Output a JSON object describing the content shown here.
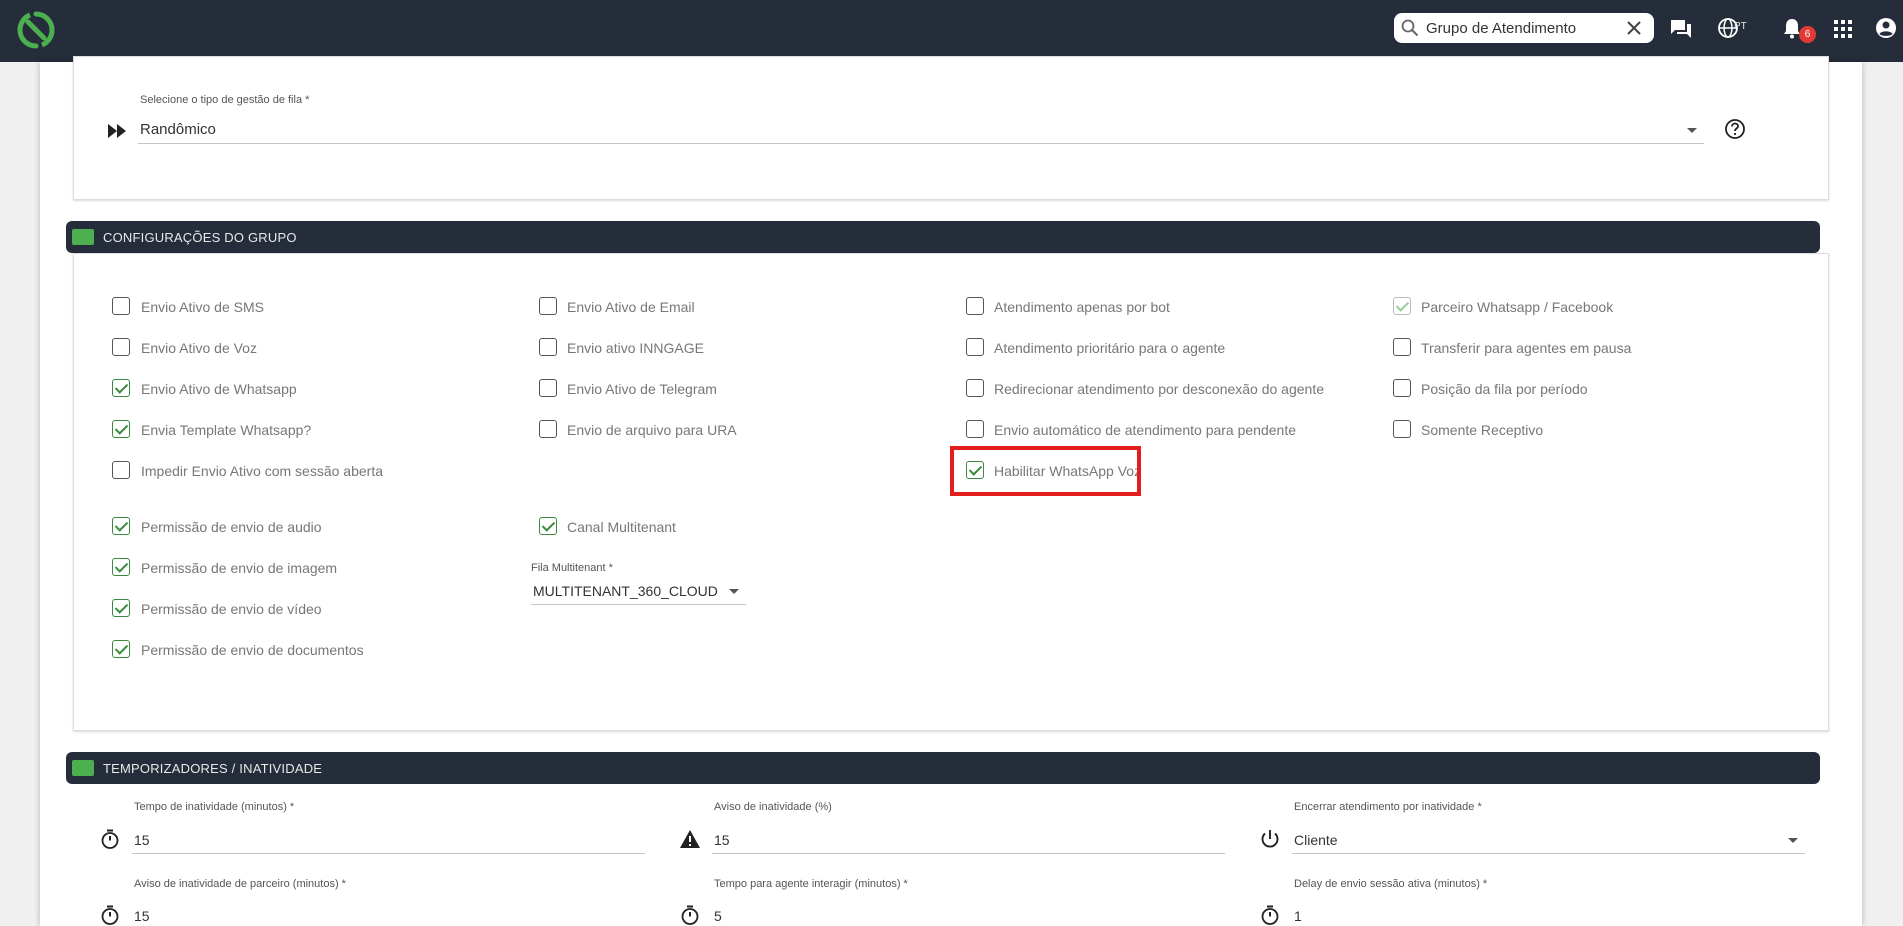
{
  "header": {
    "search": {
      "value": "Grupo de Atendimento"
    },
    "language": "PT",
    "notifications_count": "6"
  },
  "queue": {
    "label": "Selecione o tipo de gestão de fila *",
    "value": "Randômico"
  },
  "group_settings": {
    "title": "CONFIGURAÇÕES DO GRUPO",
    "checkboxes": [
      {
        "label": "Envio Ativo de SMS",
        "checked": false
      },
      {
        "label": "Envio Ativo de Email",
        "checked": false
      },
      {
        "label": "Atendimento apenas por bot",
        "checked": false
      },
      {
        "label": "Parceiro Whatsapp / Facebook",
        "checked": true,
        "disabled": true
      },
      {
        "label": "Envio Ativo de Voz",
        "checked": false
      },
      {
        "label": "Envio ativo INNGAGE",
        "checked": false
      },
      {
        "label": "Atendimento prioritário para o agente",
        "checked": false
      },
      {
        "label": "Transferir para agentes em pausa",
        "checked": false
      },
      {
        "label": "Envio Ativo de Whatsapp",
        "checked": true
      },
      {
        "label": "Envio Ativo de Telegram",
        "checked": false
      },
      {
        "label": "Redirecionar atendimento por desconexão do agente",
        "checked": false
      },
      {
        "label": "Posição da fila por período",
        "checked": false
      },
      {
        "label": "Envia Template Whatsapp?",
        "checked": true
      },
      {
        "label": "Envio de arquivo para URA",
        "checked": false
      },
      {
        "label": "Envio automático de atendimento para pendente",
        "checked": false
      },
      {
        "label": "Somente Receptivo",
        "checked": false
      },
      {
        "label": "Impedir Envio Ativo com sessão aberta",
        "checked": false
      },
      {
        "label": "Habilitar WhatsApp Voz",
        "checked": true
      },
      {
        "label": "Permissão de envio de audio",
        "checked": true
      },
      {
        "label": "Canal Multitenant",
        "checked": true
      },
      {
        "label": "Permissão de envio de imagem",
        "checked": true
      },
      {
        "label": "Permissão de envio de vídeo",
        "checked": true
      },
      {
        "label": "Permissão de envio de documentos",
        "checked": true
      }
    ],
    "multitenant_queue": {
      "label": "Fila Multitenant *",
      "value": "MULTITENANT_360_CLOUD"
    }
  },
  "timers": {
    "title": "TEMPORIZADORES / INATIVIDADE",
    "fields": [
      {
        "label": "Tempo de inatividade (minutos) *",
        "value": "15"
      },
      {
        "label": "Aviso de inatividade (%)",
        "value": "15"
      },
      {
        "label": "Encerrar atendimento por inatividade *",
        "value": "Cliente"
      },
      {
        "label": "Aviso de inatividade de parceiro (minutos) *",
        "value": "15"
      },
      {
        "label": "Tempo para agente interagir (minutos) *",
        "value": "5"
      },
      {
        "label": "Delay de envio sessão ativa (minutos) *",
        "value": "1"
      }
    ]
  }
}
